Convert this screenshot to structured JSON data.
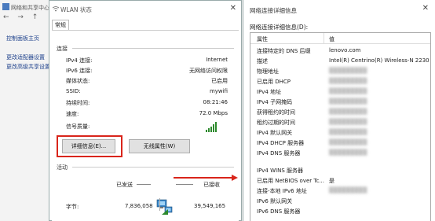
{
  "background_window": {
    "title": "网络和共享中心",
    "nav_glyphs": "← → ↑",
    "links": [
      "控制面板主页",
      "更改适配器设置",
      "更改高级共享设置"
    ]
  },
  "wlan_dialog": {
    "title": "WLAN 状态",
    "close": "✕",
    "tab": "常规",
    "connection_group": "连接",
    "connection_rows": [
      {
        "label": "IPv4 连接:",
        "value": "Internet"
      },
      {
        "label": "IPv6 连接:",
        "value": "无网络访问权限"
      },
      {
        "label": "媒体状态:",
        "value": "已启用"
      },
      {
        "label": "SSID:",
        "value": "mywifi"
      },
      {
        "label": "持续时间:",
        "value": "08:21:46"
      },
      {
        "label": "速度:",
        "value": "72.0 Mbps"
      },
      {
        "label": "信号质量:",
        "value": ""
      }
    ],
    "details_button": "详细信息(E)...",
    "wireless_button": "无线属性(W)",
    "activity_group": "活动",
    "sent_label": "已发送",
    "received_label": "已接收",
    "bytes_label": "字节:",
    "bytes_sent": "7,836,058",
    "bytes_received": "39,549,165"
  },
  "details_window": {
    "title": "网络连接详细信息",
    "close": "✕",
    "subtitle": "网络连接详细信息(D):",
    "header_property": "属性",
    "header_value": "值",
    "rows": [
      {
        "property": "连接特定的 DNS 后缀",
        "value": "lenovo.com",
        "blurred": false
      },
      {
        "property": "描述",
        "value": "Intel(R) Centrino(R) Wireless-N 2230",
        "blurred": false
      },
      {
        "property": "物理地址",
        "value": "",
        "blurred": true
      },
      {
        "property": "已启用 DHCP",
        "value": "",
        "blurred": true
      },
      {
        "property": "IPv4 地址",
        "value": "",
        "blurred": true
      },
      {
        "property": "IPv4 子网掩码",
        "value": "",
        "blurred": true
      },
      {
        "property": "获得租约的时间",
        "value": "",
        "blurred": true
      },
      {
        "property": "租约过期的时间",
        "value": "",
        "blurred": true
      },
      {
        "property": "IPv4 默认网关",
        "value": "",
        "blurred": true
      },
      {
        "property": "IPv4 DHCP 服务器",
        "value": "",
        "blurred": true
      },
      {
        "property": "IPv4 DNS 服务器",
        "value": "",
        "blurred": true
      },
      {
        "property": "",
        "value": "",
        "blurred": false
      },
      {
        "property": "IPv4 WINS 服务器",
        "value": "",
        "blurred": false
      },
      {
        "property": "已启用 NetBIOS over Tc...",
        "value": "是",
        "blurred": false
      },
      {
        "property": "连接-本地 IPv6 地址",
        "value": "",
        "blurred": true
      },
      {
        "property": "IPv6 默认网关",
        "value": "",
        "blurred": false
      },
      {
        "property": "IPv6 DNS 服务器",
        "value": "",
        "blurred": false
      }
    ]
  },
  "colors": {
    "highlight_red": "#d9251b",
    "signal_green": "#2d8a2d",
    "link_blue": "#1a3e8a"
  }
}
